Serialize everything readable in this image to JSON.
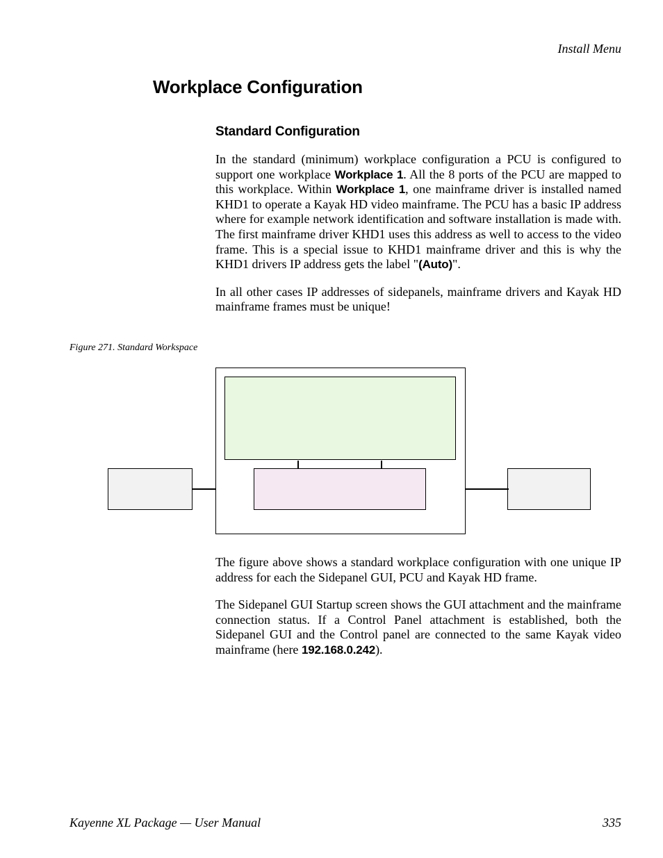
{
  "header": {
    "section": "Install Menu"
  },
  "h1": "Workplace Configuration",
  "h2": "Standard Configuration",
  "paragraphs": {
    "p1_a": "In the standard (minimum) workplace configuration a PCU is configured to support one workplace ",
    "p1_b_bold": "Workplace 1",
    "p1_c": ". All the 8 ports of the PCU are mapped to this workplace. Within ",
    "p1_d_bold": "Workplace 1",
    "p1_e": ", one mainframe driver is installed named KHD1 to operate a Kayak HD video mainframe. The PCU has a basic IP address where for example network identification and soft­ware installation is made with. The first mainframe driver KHD1 uses this address as well to access to the video frame. This is a special issue to KHD1 mainframe driver and this is why the KHD1 drivers IP address gets the label \"",
    "p1_f_bold": "(Auto)",
    "p1_g": "\".",
    "p2": "In all other cases IP addresses of sidepanels, mainframe drivers and Kayak HD mainframe frames must be unique!",
    "p3": "The figure above shows a standard workplace configuration with one unique IP address for each the Sidepanel GUI, PCU and Kayak HD frame.",
    "p4_a": "The Sidepanel GUI Startup screen shows the GUI attachment and the main­frame connection status. If a Control Panel attachment is established, both the Sidepanel GUI and the Control panel are connected to the same Kayak video mainframe (here ",
    "p4_b_bold": "192.168.0.242",
    "p4_c": ")."
  },
  "figure": {
    "caption": "Figure 271.  Standard Workspace"
  },
  "footer": {
    "left": "Kayenne XL Package — User Manual",
    "page": "335"
  }
}
